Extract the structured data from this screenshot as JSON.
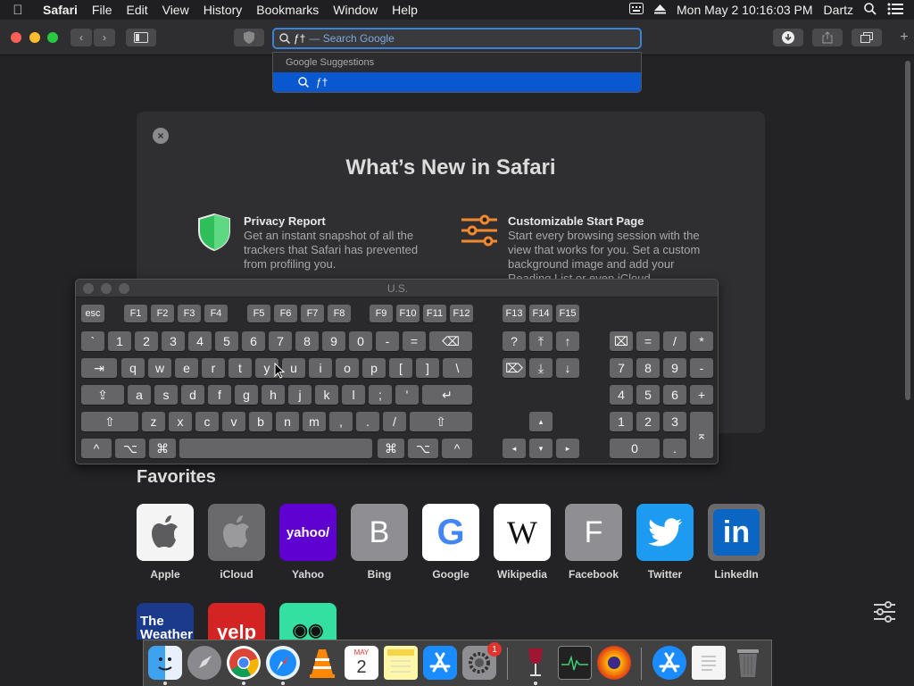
{
  "menubar": {
    "apple": "",
    "app_name": "Safari",
    "items": [
      "File",
      "Edit",
      "View",
      "History",
      "Bookmarks",
      "Window",
      "Help"
    ],
    "datetime": "Mon May 2  10:16:03 PM",
    "user": "Dartz"
  },
  "toolbar": {
    "address_typed": "ƒ†",
    "address_hint": "— Search Google"
  },
  "suggestions": {
    "header": "Google Suggestions",
    "item": "ƒ†"
  },
  "whats_new": {
    "close": "×",
    "title": "What’s New in Safari",
    "features": [
      {
        "title": "Privacy Report",
        "desc": "Get an instant snapshot of all the trackers that Safari has prevented from profiling you."
      },
      {
        "title": "Customizable Start Page",
        "desc": "Start every browsing session with the view that works for you. Set a custom background image and add your Reading List or even iCloud"
      }
    ]
  },
  "keyboard": {
    "title": "U.S.",
    "fn_row": [
      "esc",
      "F1",
      "F2",
      "F3",
      "F4",
      "F5",
      "F6",
      "F7",
      "F8",
      "F9",
      "F10",
      "F11",
      "F12",
      "F13",
      "F14",
      "F15"
    ],
    "row1": [
      "`",
      "1",
      "2",
      "3",
      "4",
      "5",
      "6",
      "7",
      "8",
      "9",
      "0",
      "-",
      "=",
      "⌫"
    ],
    "row2": [
      "⇥",
      "q",
      "w",
      "e",
      "r",
      "t",
      "y",
      "u",
      "i",
      "o",
      "p",
      "[",
      "]",
      "\\"
    ],
    "row3": [
      "⇪",
      "a",
      "s",
      "d",
      "f",
      "g",
      "h",
      "j",
      "k",
      "l",
      ";",
      "'",
      "↵"
    ],
    "row4": [
      "⇧",
      "z",
      "x",
      "c",
      "v",
      "b",
      "n",
      "m",
      ",",
      ".",
      "/",
      "⇧"
    ],
    "row5": [
      "^",
      "⌥",
      "⌘",
      "",
      "⌘",
      "⌥",
      "^"
    ],
    "nav": [
      "?",
      "⤒",
      "↑",
      "⌦",
      "⤓",
      "↓",
      "▴",
      "◂",
      "▾",
      "▸"
    ],
    "numpad": [
      "⌧",
      "=",
      "/",
      "*",
      "7",
      "8",
      "9",
      "-",
      "4",
      "5",
      "6",
      "+",
      "1",
      "2",
      "3",
      "⌅",
      "0",
      "."
    ]
  },
  "favorites": {
    "title": "Favorites",
    "items": [
      {
        "name": "Apple",
        "glyph": "",
        "color": "#f4f4f4"
      },
      {
        "name": "iCloud",
        "glyph": "",
        "color": "#6a6a6c"
      },
      {
        "name": "Yahoo",
        "glyph": "yahoo/",
        "color": "#5f01d1"
      },
      {
        "name": "Bing",
        "glyph": "B",
        "color": "#8e8e93"
      },
      {
        "name": "Google",
        "glyph": "G",
        "color": "#ffffff"
      },
      {
        "name": "Wikipedia",
        "glyph": "W",
        "color": "#ffffff"
      },
      {
        "name": "Facebook",
        "glyph": "F",
        "color": "#8e8e93"
      },
      {
        "name": "Twitter",
        "glyph": "🐦",
        "color": "#1d9bf0"
      },
      {
        "name": "LinkedIn",
        "glyph": "in",
        "color": "#0a66c2"
      }
    ],
    "row2": [
      {
        "name": "The Weather",
        "glyph": "The\nWeather",
        "color": "#1b3a8c"
      },
      {
        "name": "Yelp",
        "glyph": "yelp",
        "color": "#d32323"
      },
      {
        "name": "Tripadvisor",
        "glyph": "◉◉",
        "color": "#34e0a1"
      }
    ]
  },
  "dock": {
    "calendar_month": "MAY",
    "calendar_day": "2",
    "settings_badge": "1"
  }
}
